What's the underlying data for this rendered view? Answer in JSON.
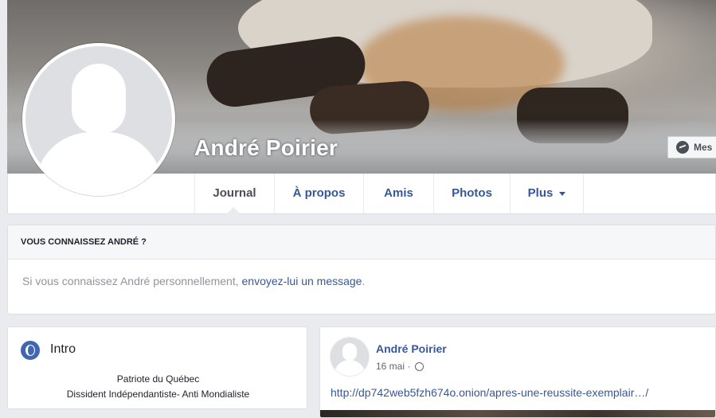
{
  "profile": {
    "name": "André Poirier",
    "message_button": "Mes"
  },
  "tabs": [
    {
      "label": "Journal"
    },
    {
      "label": "À propos"
    },
    {
      "label": "Amis"
    },
    {
      "label": "Photos"
    },
    {
      "label": "Plus"
    }
  ],
  "know_box": {
    "header": "VOUS CONNAISSEZ ANDRÉ ?",
    "text_before": "Si vous connaissez André personnellement, ",
    "link": "envoyez-lui un message",
    "text_after": "."
  },
  "intro": {
    "title": "Intro",
    "line1": "Patriote du Québec",
    "line2": "Dissident Indépendantiste- Anti Mondialiste"
  },
  "post": {
    "author": "André Poirier",
    "date": "16 mai · ",
    "link": "http://dp742web5fzh674o.onion/apres-une-reussite-exemplair…/"
  },
  "icons": {
    "messenger": "messenger-icon",
    "intro": "globe-icon",
    "privacy": "globe-icon",
    "more": "caret-down-icon"
  },
  "colors": {
    "link_blue": "#365899",
    "background": "#e9ebee"
  }
}
